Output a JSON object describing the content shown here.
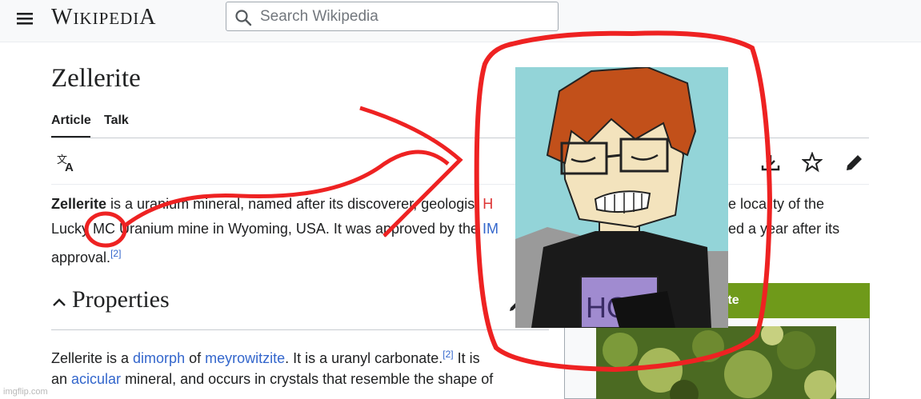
{
  "header": {
    "logo_first": "W",
    "logo_rest": "IKIPEDI",
    "logo_last": "A",
    "search_placeholder": "Search Wikipedia"
  },
  "page": {
    "title": "Zellerite",
    "tabs": [
      "Article",
      "Talk"
    ]
  },
  "toolbar": {
    "icons": [
      "translate-icon",
      "download-icon",
      "star-icon",
      "edit-icon"
    ]
  },
  "intro": {
    "line1_bold": "Zellerite",
    "line1_a": " is a uranium mineral, named after its discoverer, geologist ",
    "line1_redlink": "H",
    "line1_b": "e locality of the",
    "line2_a": "Lucky MC Uranium mine in Wyoming, USA. It was approved by the ",
    "line2_link": "IM",
    "line2_b": "ed a year after its",
    "line3": "approval.",
    "line3_ref": "[2]"
  },
  "section": {
    "heading": "Properties",
    "p1_a": "Zellerite is a ",
    "p1_link1": "dimorph",
    "p1_b": " of ",
    "p1_link2": "meyrowitzite",
    "p1_c": ". It is a uranyl carbonate.",
    "p1_ref": "[2]",
    "p1_d": " It is",
    "p2_a": "an ",
    "p2_link": "acicular",
    "p2_b": " mineral, and occurs in crystals that resemble the shape of"
  },
  "infobox": {
    "heading_visible": "ite"
  },
  "meme": {
    "shirt_text": "HOW"
  },
  "watermark": "imgflip.com",
  "colors": {
    "link": "#3366cc",
    "redlink": "#dd3333",
    "annotation": "#ee2222",
    "infobox_header": "#6f9a1a"
  }
}
